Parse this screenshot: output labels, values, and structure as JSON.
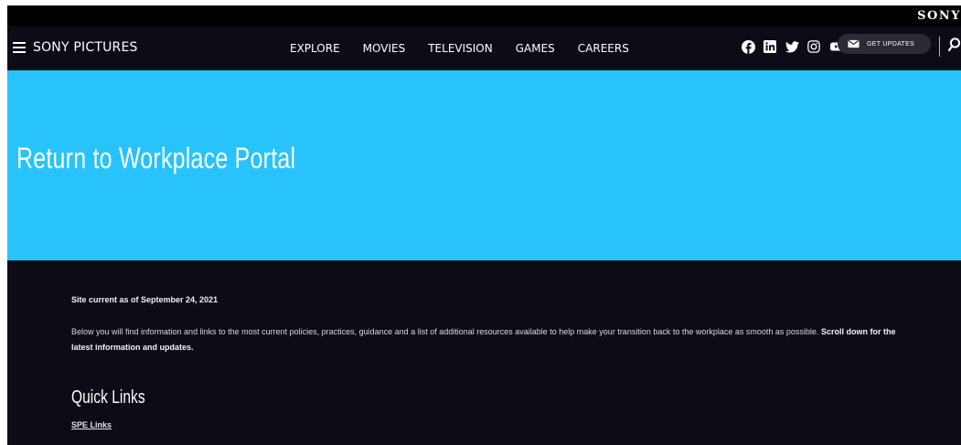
{
  "brand": {
    "corporate_logo": "SONY"
  },
  "nav": {
    "menu_icon": "hamburger-menu-icon",
    "site_name": "SONY PICTURES",
    "links": [
      "EXPLORE",
      "MOVIES",
      "TELEVISION",
      "GAMES",
      "CAREERS"
    ],
    "social_icons": [
      "facebook-icon",
      "linkedin-icon",
      "twitter-icon",
      "instagram-icon",
      "youtube-icon"
    ],
    "updates_label": "GET UPDATES",
    "search_icon": "search-icon"
  },
  "hero": {
    "title": "Return to Workplace Portal",
    "background": "#28c3fb"
  },
  "content": {
    "current_as_of": "Site current as of September 24, 2021",
    "intro_text": "Below you will find information and links to the most current policies, practices, guidance and a list of additional resources available to help make your transition back to the workplace as smooth as possible.",
    "intro_bold": "Scroll down for the latest information and updates.",
    "quick_links_heading": "Quick Links",
    "spe_links_label": "SPE Links"
  },
  "colors": {
    "page_bg": "#0b0c16",
    "accent": "#28c3fb",
    "brand_strip": "#000000"
  }
}
